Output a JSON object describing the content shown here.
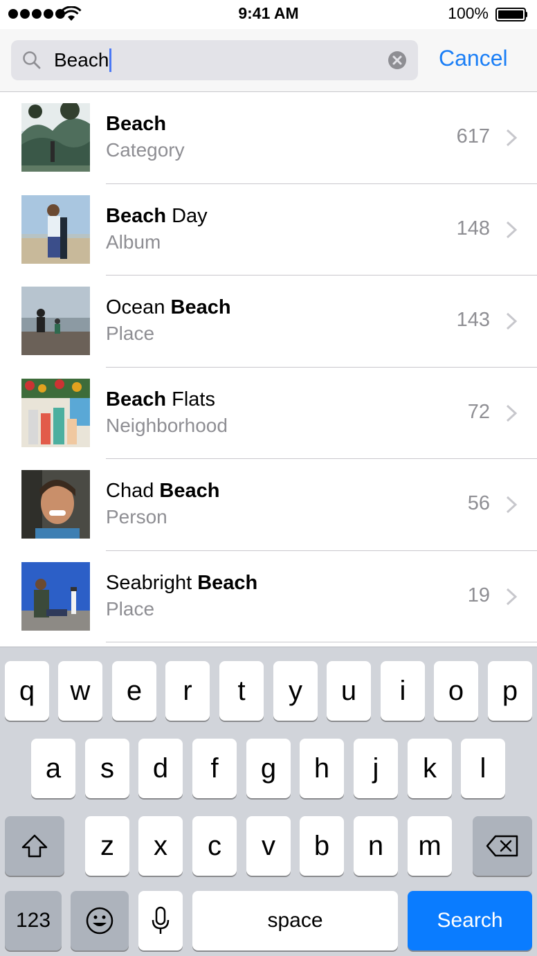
{
  "status_bar": {
    "time": "9:41 AM",
    "battery": "100%"
  },
  "search": {
    "value": "Beach",
    "cancel_label": "Cancel"
  },
  "results": [
    {
      "title_bold": "Beach",
      "title_rest": "",
      "title_prefix": "",
      "subtitle": "Category",
      "count": "617"
    },
    {
      "title_bold": "Beach",
      "title_rest": " Day",
      "title_prefix": "",
      "subtitle": "Album",
      "count": "148"
    },
    {
      "title_prefix": "Ocean ",
      "title_bold": "Beach",
      "title_rest": "",
      "subtitle": "Place",
      "count": "143"
    },
    {
      "title_bold": "Beach",
      "title_rest": " Flats",
      "title_prefix": "",
      "subtitle": "Neighborhood",
      "count": "72"
    },
    {
      "title_prefix": "Chad ",
      "title_bold": "Beach",
      "title_rest": "",
      "subtitle": "Person",
      "count": "56"
    },
    {
      "title_prefix": "Seabright ",
      "title_bold": "Beach",
      "title_rest": "",
      "subtitle": "Place",
      "count": "19"
    }
  ],
  "keyboard": {
    "row1": [
      "q",
      "w",
      "e",
      "r",
      "t",
      "y",
      "u",
      "i",
      "o",
      "p"
    ],
    "row2": [
      "a",
      "s",
      "d",
      "f",
      "g",
      "h",
      "j",
      "k",
      "l"
    ],
    "row3": [
      "z",
      "x",
      "c",
      "v",
      "b",
      "n",
      "m"
    ],
    "numbers_label": "123",
    "space_label": "space",
    "search_label": "Search"
  },
  "colors": {
    "accent": "#1a7ef6",
    "search_key": "#0a7cff"
  }
}
